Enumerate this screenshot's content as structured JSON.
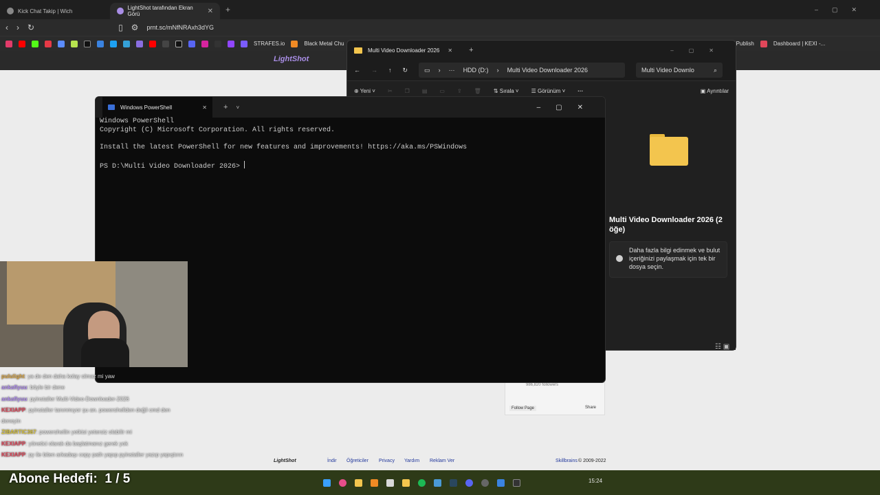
{
  "browser": {
    "tabs": [
      {
        "title": "Kick Chat Takip | Wich"
      },
      {
        "title": "LightShot tarafından Ekran Görü"
      }
    ],
    "url": "prnt.sc/mNfNRAxh3dYG",
    "bookmarks": [
      "STRAFES.io",
      "Black Metal Chu",
      "ler - Publish",
      "Dashboard | KEXI -..."
    ]
  },
  "lightshot": {
    "footer_links": [
      "İndir",
      "Öğreticiler",
      "Privacy",
      "Yardım",
      "Reklam Ver"
    ],
    "footer_brand": "LightShot",
    "copyright": "© 2009-2022",
    "skillbrains": "Skillbrains",
    "fb_followers": "986,820 followers",
    "follow_page": "Follow Page",
    "share": "Share"
  },
  "explorer": {
    "tab_title": "Multi Video Downloader 2026",
    "breadcrumb_drive": "HDD  (D:)",
    "breadcrumb_folder": "Multi Video Downloader 2026",
    "search_placeholder": "Multi Video Downlo",
    "cmd_new": "Yeni",
    "cmd_sort": "Sırala",
    "cmd_view": "Görünüm",
    "cmd_details": "Ayrıntılar",
    "details_title": "Multi Video Downloader 2026 (2 öğe)",
    "details_info": "Daha fazla bilgi edinmek ve bulut içeriğinizi paylaşmak için tek bir dosya seçin."
  },
  "powershell": {
    "tab_title": "Windows PowerShell",
    "lines": [
      "Windows PowerShell",
      "Copyright (C) Microsoft Corporation. All rights reserved.",
      "",
      "Install the latest PowerShell for new features and improvements! https://aka.ms/PSWindows",
      "",
      "PS D:\\Multi Video Downloader 2026> "
    ]
  },
  "chat": [
    {
      "user": "pululight",
      "color": "#d9a441",
      "msg": ": ya de den daha kolay olmaz mi yaw"
    },
    {
      "user": "ankaflyuu",
      "color": "#b08cf0",
      "msg": ": böyle bir dene"
    },
    {
      "user": "ankaflyuu",
      "color": "#b08cf0",
      "msg": ": pyinstaller Multi-Video-Downloader-2026"
    },
    {
      "user": "KEXIAPP",
      "color": "#e0475a",
      "msg": ": pyinstaller tanınmıyor şu an. powershellden değil cmd den deneyin"
    },
    {
      "user": "ZIBARTIC367",
      "color": "#d8c23a",
      "msg": ": powershellin yetkisi yetersiz olabilir mi"
    },
    {
      "user": "KEXIAPP",
      "color": "#e0475a",
      "msg": ": yönetici olarak da başlatmanız gerek yok"
    },
    {
      "user": "KEXIAPP",
      "color": "#e0475a",
      "msg": ": py ile biten arkadaşı copy ",
      "extra": "path yapıp pyinstaller yazıp yapıştırın"
    }
  ],
  "goal": {
    "label": "Abone Hedefi:",
    "value": "1 / 5"
  },
  "taskbar": {
    "clock": "15:24"
  }
}
